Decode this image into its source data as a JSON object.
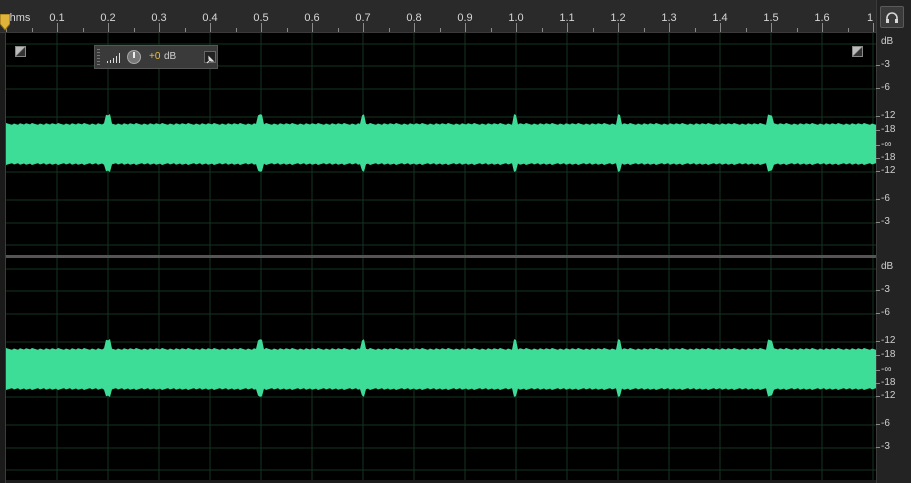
{
  "ruler": {
    "unit_label": "hms",
    "labels": [
      "0.1",
      "0.2",
      "0.3",
      "0.4",
      "0.5",
      "0.6",
      "0.7",
      "0.8",
      "0.9",
      "1.0",
      "1.1",
      "1.2",
      "1.3",
      "1.4",
      "1.5",
      "1.6",
      "1"
    ]
  },
  "hud": {
    "gain_value": "+0",
    "gain_unit": "dB"
  },
  "db_scale": {
    "header": "dB",
    "labels": [
      "-3",
      "-6",
      "-12",
      "-18",
      "-∞",
      "-18",
      "-12",
      "-6",
      "-3"
    ]
  },
  "colors": {
    "waveform": "#3ddc97",
    "background": "#000000",
    "grid": "#1f3a2a"
  },
  "icons": {
    "headphone": "headphone-icon",
    "pin": "pin-icon",
    "playhead": "playhead-icon"
  }
}
